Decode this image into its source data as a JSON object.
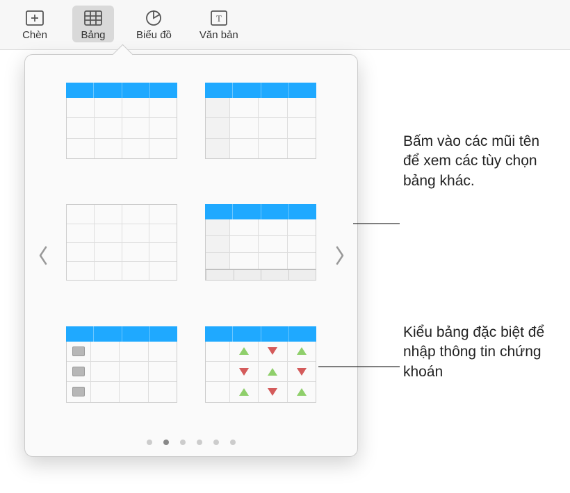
{
  "toolbar": {
    "insert": {
      "label": "Chèn"
    },
    "table": {
      "label": "Bảng"
    },
    "chart": {
      "label": "Biểu đồ"
    },
    "text": {
      "label": "Văn bản"
    }
  },
  "popover": {
    "styles": [
      {
        "id": "style-header-basic",
        "name": "table-style-header-basic"
      },
      {
        "id": "style-header-firstcol",
        "name": "table-style-header-firstcol"
      },
      {
        "id": "style-plain",
        "name": "table-style-plain"
      },
      {
        "id": "style-header-footer",
        "name": "table-style-header-footer"
      },
      {
        "id": "style-checklist",
        "name": "table-style-checklist"
      },
      {
        "id": "style-stocks",
        "name": "table-style-stocks"
      }
    ],
    "page_count": 6,
    "active_page_index": 1
  },
  "callouts": {
    "arrows": "Bấm vào các mũi tên để xem các tùy chọn bảng khác.",
    "stocks": "Kiểu bảng đặc biệt để nhập thông tin chứng khoán"
  }
}
